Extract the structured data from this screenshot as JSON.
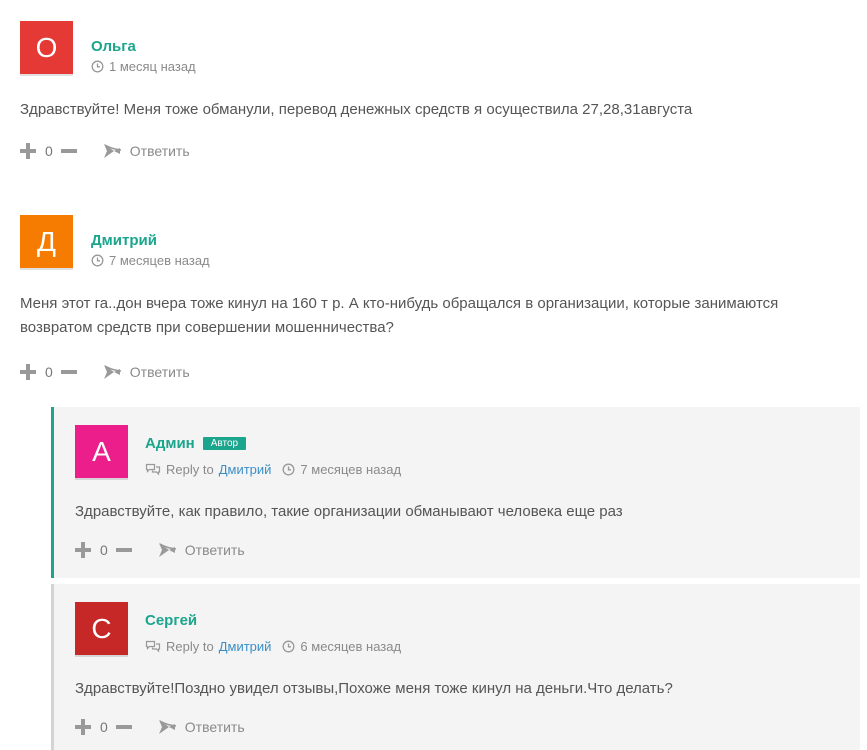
{
  "colors": {
    "accent": "#1aa58c",
    "link": "#3a8fc8",
    "avatar_olga": "#e53935",
    "avatar_dmitriy": "#f57c00",
    "avatar_admin": "#ec1e8c",
    "avatar_sergey": "#c62828"
  },
  "comments": [
    {
      "avatar_letter": "О",
      "author": "Ольга",
      "time": "1 месяц назад",
      "text": "Здравствуйте! Меня тоже обманули, перевод денежных средств я осуществила 27,28,31августа",
      "votes": "0",
      "reply_label": "Ответить"
    },
    {
      "avatar_letter": "Д",
      "author": "Дмитрий",
      "time": "7 месяцев назад",
      "text": "Меня этот га..дон вчера тоже кинул на 160 т р. А кто-нибудь обращался в организации, которые занимаются возвратом средств при совершении мошенничества?",
      "votes": "0",
      "reply_label": "Ответить"
    }
  ],
  "replies": [
    {
      "avatar_letter": "А",
      "author": "Админ",
      "badge": "Автор",
      "reply_to_label": "Reply to",
      "reply_to_name": "Дмитрий",
      "time": "7 месяцев назад",
      "text": "Здравствуйте, как правило, такие организации обманывают человека еще раз",
      "votes": "0",
      "reply_label": "Ответить"
    },
    {
      "avatar_letter": "С",
      "author": "Сергей",
      "reply_to_label": "Reply to",
      "reply_to_name": "Дмитрий",
      "time": "6 месяцев назад",
      "text": "Здравствуйте!Поздно увидел отзывы,Похоже меня тоже кинул на деньги.Что делать?",
      "votes": "0",
      "reply_label": "Ответить"
    }
  ]
}
